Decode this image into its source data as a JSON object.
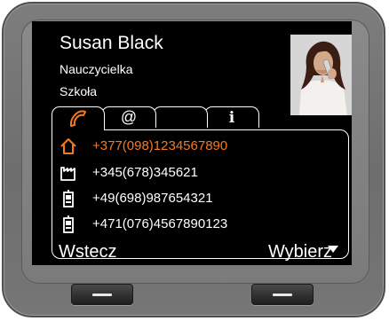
{
  "contact": {
    "name": "Susan Black",
    "role": "Nauczycielka",
    "organization": "Szkoła"
  },
  "tabs": [
    {
      "icon": "phone-handset-icon",
      "active": true
    },
    {
      "icon": "at-sign-icon",
      "label": "@",
      "active": false
    },
    {
      "icon": "blank-tab",
      "active": false
    },
    {
      "icon": "info-icon",
      "label": "i",
      "active": false
    }
  ],
  "numbers": [
    {
      "icon": "home-icon",
      "value": "+377(098)1234567890",
      "selected": true
    },
    {
      "icon": "office-building-icon",
      "value": "+345(678)345621",
      "selected": false
    },
    {
      "icon": "mobile-phone-icon",
      "value": "+49(698)987654321",
      "selected": false
    },
    {
      "icon": "mobile-phone-icon",
      "value": "+471(076)4567890123",
      "selected": false
    }
  ],
  "softkeys": {
    "left": "Wstecz",
    "right": "Wybierz"
  },
  "colors": {
    "highlight": "#f47920",
    "text": "#ffffff",
    "screen_bg": "#000000",
    "bezel": "#7a7a7a"
  }
}
